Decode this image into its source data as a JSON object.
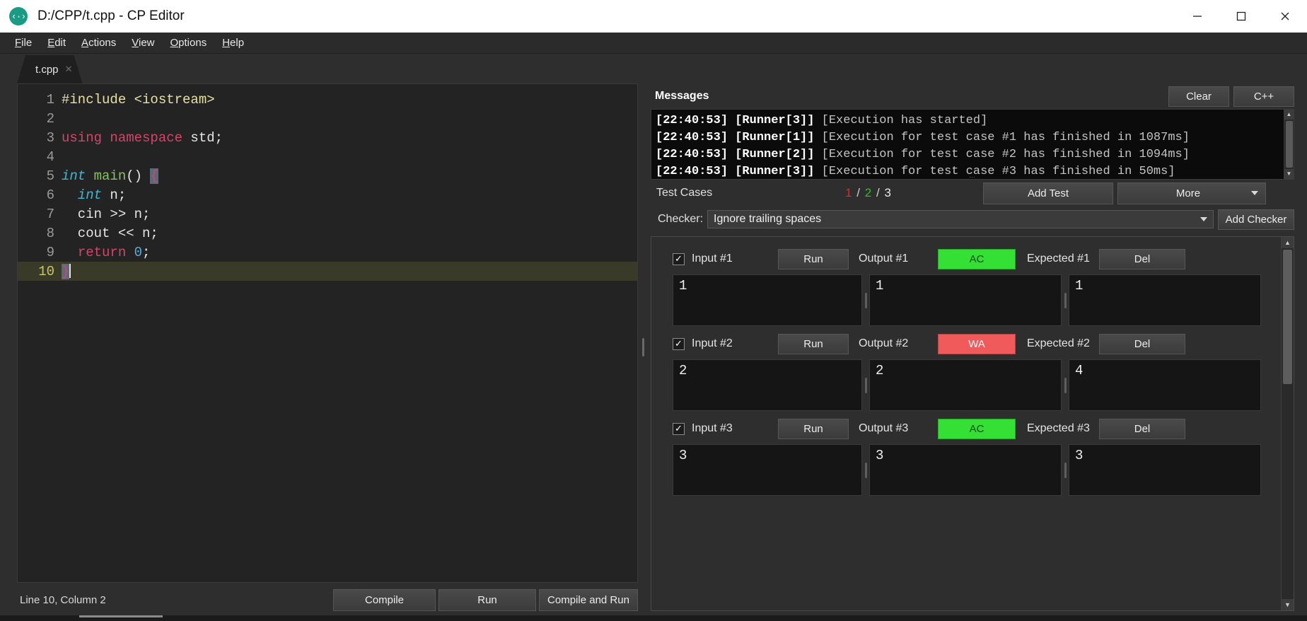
{
  "window": {
    "title": "D:/CPP/t.cpp - CP Editor",
    "logo_glyph": "‹·›",
    "minimize_label": "—",
    "maximize_label": "☐",
    "close_label": "✕"
  },
  "menubar": {
    "items": [
      {
        "label": "File",
        "mnemonic": "F"
      },
      {
        "label": "Edit",
        "mnemonic": "E"
      },
      {
        "label": "Actions",
        "mnemonic": "A"
      },
      {
        "label": "View",
        "mnemonic": "V"
      },
      {
        "label": "Options",
        "mnemonic": "O"
      },
      {
        "label": "Help",
        "mnemonic": "H"
      }
    ]
  },
  "tabs": [
    {
      "label": "t.cpp",
      "close_glyph": "✕",
      "active": true
    }
  ],
  "editor": {
    "lines": [
      {
        "num": "1",
        "text": "#include <iostream>"
      },
      {
        "num": "2",
        "text": ""
      },
      {
        "num": "3",
        "text": "using namespace std;"
      },
      {
        "num": "4",
        "text": ""
      },
      {
        "num": "5",
        "text": "int main() {"
      },
      {
        "num": "6",
        "text": "  int n;"
      },
      {
        "num": "7",
        "text": "  cin >> n;"
      },
      {
        "num": "8",
        "text": "  cout << n;"
      },
      {
        "num": "9",
        "text": "  return 0;"
      },
      {
        "num": "10",
        "text": "}"
      }
    ],
    "current_line": 10,
    "status": "Line 10, Column 2"
  },
  "toolbar": {
    "compile_label": "Compile",
    "run_label": "Run",
    "compile_and_run_label": "Compile and Run"
  },
  "messages": {
    "title": "Messages",
    "clear_label": "Clear",
    "language_label": "C++",
    "lines": [
      {
        "stamp": "[22:40:53] [Runner[3]]",
        "body": " [Execution has started]"
      },
      {
        "stamp": "[22:40:53] [Runner[1]]",
        "body": " [Execution for test case #1 has finished in 1087ms]"
      },
      {
        "stamp": "[22:40:53] [Runner[2]]",
        "body": " [Execution for test case #2 has finished in 1094ms]"
      },
      {
        "stamp": "[22:40:53] [Runner[3]]",
        "body": " [Execution for test case #3 has finished in 50ms]"
      }
    ],
    "scroll_up_glyph": "▲",
    "scroll_down_glyph": "▼",
    "resize_grip_glyph": "⋯"
  },
  "testcases_bar": {
    "label": "Test Cases",
    "failed": "1",
    "passed": "2",
    "total": "3",
    "separator": "/",
    "add_test_label": "Add Test",
    "more_label": "More"
  },
  "checker": {
    "label": "Checker:",
    "value": "Ignore trailing spaces",
    "add_checker_label": "Add Checker"
  },
  "testcases": [
    {
      "checked": true,
      "check_glyph": "✓",
      "input_label": "Input #1",
      "run_label": "Run",
      "output_label": "Output #1",
      "verdict": "AC",
      "verdict_kind": "ac",
      "expected_label": "Expected #1",
      "del_label": "Del",
      "input_value": "1",
      "output_value": "1",
      "expected_value": "1"
    },
    {
      "checked": true,
      "check_glyph": "✓",
      "input_label": "Input #2",
      "run_label": "Run",
      "output_label": "Output #2",
      "verdict": "WA",
      "verdict_kind": "wa",
      "expected_label": "Expected #2",
      "del_label": "Del",
      "input_value": "2",
      "output_value": "2",
      "expected_value": "4"
    },
    {
      "checked": true,
      "check_glyph": "✓",
      "input_label": "Input #3",
      "run_label": "Run",
      "output_label": "Output #3",
      "verdict": "AC",
      "verdict_kind": "ac",
      "expected_label": "Expected #3",
      "del_label": "Del",
      "input_value": "3",
      "output_value": "3",
      "expected_value": "3"
    }
  ],
  "colors": {
    "accent_green": "#33e033",
    "accent_red": "#f05a5a",
    "counter_fail": "#d03030",
    "counter_pass": "#2fbd2f",
    "logo": "#1a9b84",
    "window_bg": "#2e2e2e",
    "editor_bg": "#232323",
    "console_bg": "#0b0b0b"
  }
}
